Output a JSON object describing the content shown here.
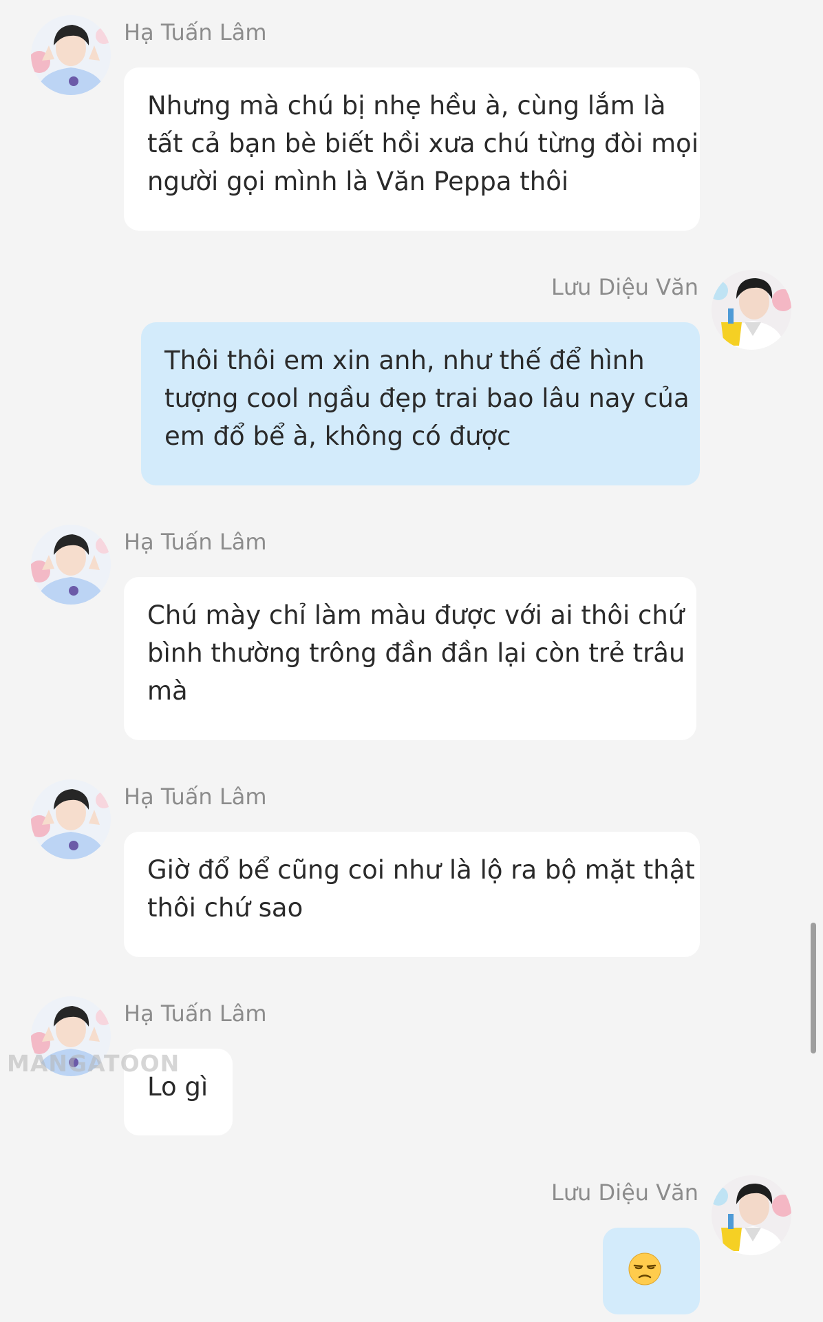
{
  "messages": [
    {
      "side": "left",
      "sender": "Hạ Tuấn Lâm",
      "lines": [
        "Nhưng mà chú bị nhẹ hều à, cùng lắm là",
        "tất cả bạn bè biết hồi xưa chú từng đòi mọi",
        "người gọi mình là Văn Peppa thôi"
      ]
    },
    {
      "side": "right",
      "sender": "Lưu Diệu Văn",
      "lines": [
        "Thôi thôi em xin anh, như thế để hình",
        "tượng cool ngầu đẹp trai bao lâu nay của",
        "em đổ bể à, không có được"
      ]
    },
    {
      "side": "left",
      "sender": "Hạ Tuấn Lâm",
      "lines": [
        "Chú mày chỉ làm màu được với ai thôi chứ",
        "bình thường trông đần đần lại còn trẻ trâu",
        "mà"
      ]
    },
    {
      "side": "left",
      "sender": "Hạ Tuấn Lâm",
      "lines": [
        "Giờ đổ bể cũng coi như là lộ ra bộ mặt thật",
        "thôi chứ sao"
      ]
    },
    {
      "side": "left",
      "sender": "Hạ Tuấn Lâm",
      "lines": [
        "Lo gì"
      ]
    },
    {
      "side": "right",
      "sender": "Lưu Diệu Văn",
      "emoji": "unamused-face-emoji"
    }
  ],
  "watermark": "MANGATOON",
  "colors": {
    "background": "#f4f4f4",
    "bubble_left": "#ffffff",
    "bubble_right": "#d3ebfb",
    "text": "#2a2a2a",
    "sender": "#8c8c8c"
  }
}
